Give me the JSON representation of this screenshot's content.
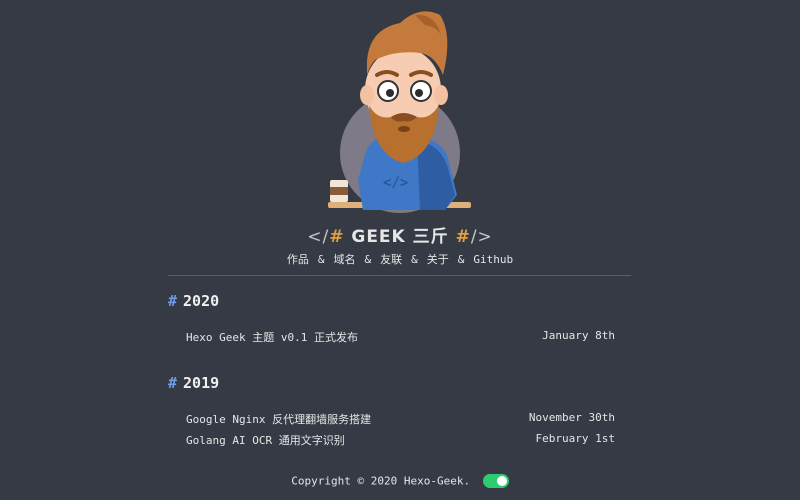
{
  "site": {
    "title_prefix": "</",
    "title_hash_left": "#",
    "title_text": "GEEK 三斤",
    "title_hash_right": "#",
    "title_suffix": "/>"
  },
  "nav": {
    "items": [
      "作品",
      "域名",
      "友联",
      "关于",
      "Github"
    ],
    "separator": "&"
  },
  "archive": [
    {
      "year": "2020",
      "posts": [
        {
          "title": "Hexo Geek 主题 v0.1 正式发布",
          "date": "January 8th"
        }
      ]
    },
    {
      "year": "2019",
      "posts": [
        {
          "title": "Google Nginx 反代理翻墙服务搭建",
          "date": "November 30th"
        },
        {
          "title": "Golang AI OCR 通用文字识别",
          "date": "February 1st"
        }
      ]
    }
  ],
  "footer": {
    "copyright": "Copyright © 2020 Hexo-Geek."
  },
  "icons": {
    "avatar": "bearded-geek-avatar",
    "toggle": "theme-toggle"
  },
  "colors": {
    "background": "#363a45",
    "accent_blue": "#6f9be8",
    "accent_orange": "#e2a03f",
    "toggle_green": "#2ecc71"
  },
  "hash_mark": "#"
}
